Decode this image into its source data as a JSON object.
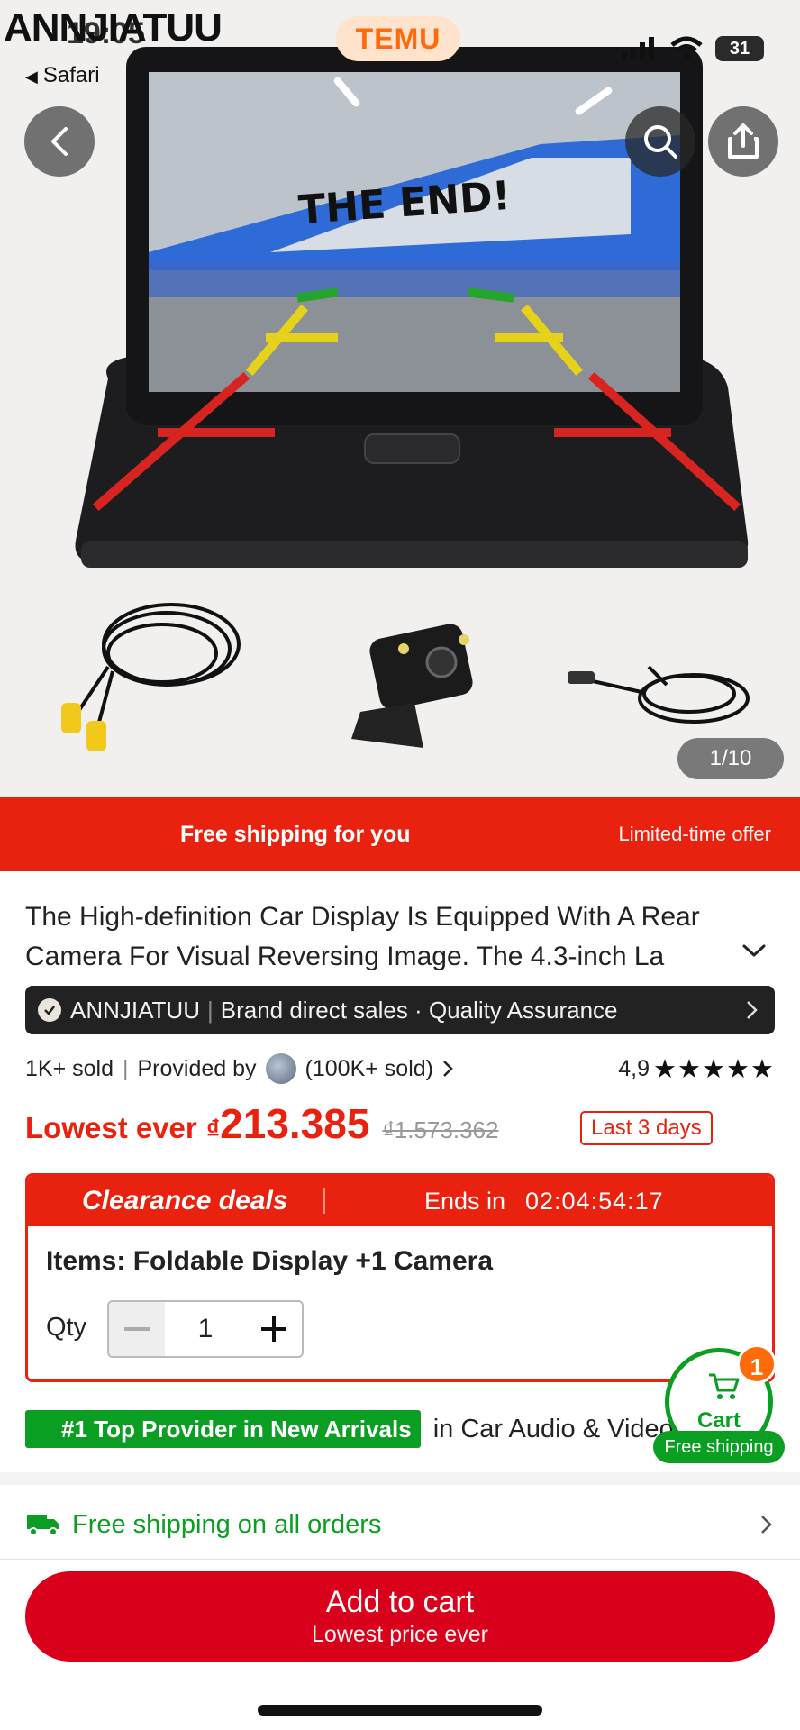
{
  "overlay": {
    "watermark": "ANNJIATUU",
    "time": "19:05",
    "safari_label": "Safari",
    "temu_logo": "TEMU",
    "battery": "31"
  },
  "gallery": {
    "counter": "1/10",
    "screen_text": "THE END!"
  },
  "banner": {
    "main": "Free shipping for you",
    "side": "Limited-time offer"
  },
  "product": {
    "title": "The High-definition Car Display Is Equipped With A Rear Camera For Visual Reversing Image. The 4.3-inch La",
    "brand_name": "ANNJIATUU",
    "brand_tagline": "Brand direct sales · Quality Assurance",
    "sold": "1K+ sold",
    "provided_by": "Provided by",
    "provider_sold": "(100K+ sold)",
    "rating": "4,9",
    "stars": "★★★★★"
  },
  "price": {
    "lowest_label": "Lowest ever",
    "currency": "₫",
    "current": "213.385",
    "old": "₫1.573.362",
    "last_days": "Last 3 days"
  },
  "clearance": {
    "title": "Clearance deals",
    "ends_label": "Ends in",
    "timer": "02:04:54:17",
    "items": "Items: Foldable Display +1 Camera",
    "qty_label": "Qty",
    "qty_value": "1"
  },
  "provider": {
    "badge": "#1 Top Provider in New Arrivals",
    "category": "in Car Audio & Video"
  },
  "cart": {
    "label": "Cart",
    "count": "1",
    "free_shipping": "Free shipping"
  },
  "shipping": {
    "text": "Free shipping on all orders"
  },
  "add_to_cart": {
    "label": "Add to cart",
    "sub": "Lowest price ever"
  },
  "colors": {
    "brand_red": "#e8220f",
    "cta_red": "#d9001b",
    "green": "#0a9e22",
    "temu_orange": "#ff6a0a"
  }
}
